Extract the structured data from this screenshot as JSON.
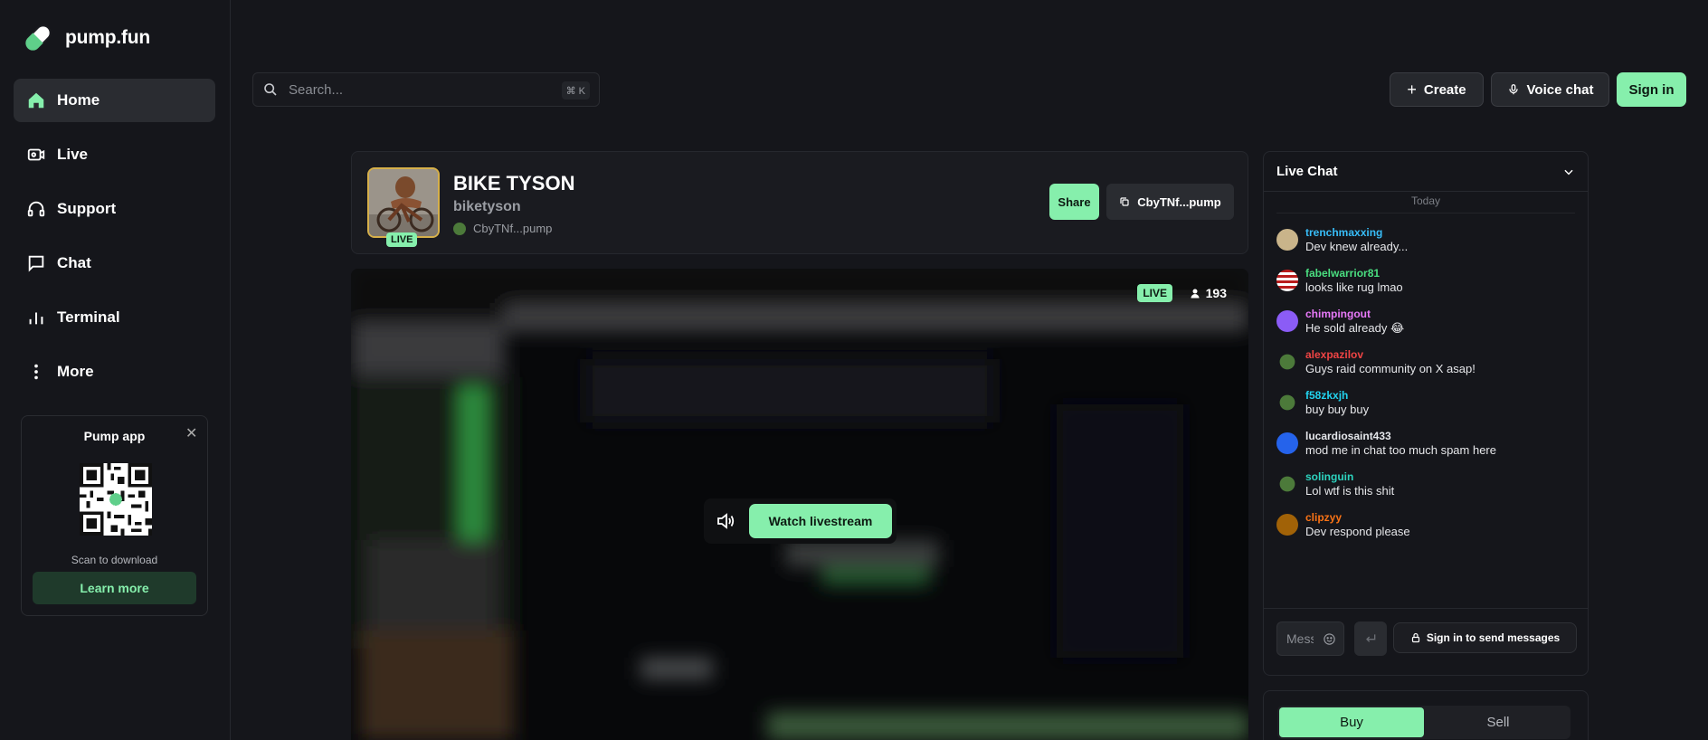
{
  "brand": {
    "name": "pump.fun"
  },
  "nav": {
    "items": [
      {
        "label": "Home",
        "icon": "home-icon",
        "active": true
      },
      {
        "label": "Live",
        "icon": "live-icon",
        "active": false
      },
      {
        "label": "Support",
        "icon": "headset-icon",
        "active": false
      },
      {
        "label": "Chat",
        "icon": "chat-icon",
        "active": false
      },
      {
        "label": "Terminal",
        "icon": "chart-bars-icon",
        "active": false
      },
      {
        "label": "More",
        "icon": "more-dots-icon",
        "active": false
      }
    ]
  },
  "app_card": {
    "title": "Pump app",
    "scan_text": "Scan to download",
    "learn_more": "Learn more"
  },
  "search": {
    "placeholder": "Search...",
    "shortcut": "⌘ K"
  },
  "topbar": {
    "create": "Create",
    "voice_chat": "Voice chat",
    "sign_in": "Sign in"
  },
  "stream": {
    "title": "BIKE TYSON",
    "handle": "biketyson",
    "address": "CbyTNf...pump",
    "live_tag": "LIVE",
    "share": "Share",
    "copy_address": "CbyTNf...pump",
    "video_live": "LIVE",
    "viewers": "193",
    "watch": "Watch livestream"
  },
  "chat": {
    "title": "Live Chat",
    "day": "Today",
    "messages": [
      {
        "user": "trenchmaxxing",
        "text": "Dev knew already...",
        "color": "#38bdf8",
        "avatar": "#c9b48a"
      },
      {
        "user": "fabelwarrior81",
        "text": "looks like rug lmao",
        "color": "#4ade80",
        "avatar": "#b91c1c"
      },
      {
        "user": "chimpingout",
        "text": "He sold already 😂",
        "color": "#e879f9",
        "avatar": "#8b5cf6"
      },
      {
        "user": "alexpazilov",
        "text": "Guys raid community on X asap!",
        "color": "#ef4444",
        "avatar": "#4c7a3a"
      },
      {
        "user": "f58zkxjh",
        "text": "buy buy buy",
        "color": "#22d3ee",
        "avatar": "#4c7a3a"
      },
      {
        "user": "lucardiosaint433",
        "text": "mod me in chat too much spam here",
        "color": "#e5e7eb",
        "avatar": "#2563eb"
      },
      {
        "user": "solinguin",
        "text": "Lol wtf is this shit",
        "color": "#2dd4bf",
        "avatar": "#4c7a3a"
      },
      {
        "user": "clipzyy",
        "text": "Dev respond please",
        "color": "#f97316",
        "avatar": "#a16207"
      }
    ],
    "input_placeholder": "Message",
    "sign_in_send": "Sign in to send messages"
  },
  "trade": {
    "buy": "Buy",
    "sell": "Sell"
  },
  "colors": {
    "accent": "#86efac",
    "background": "#15161b"
  }
}
